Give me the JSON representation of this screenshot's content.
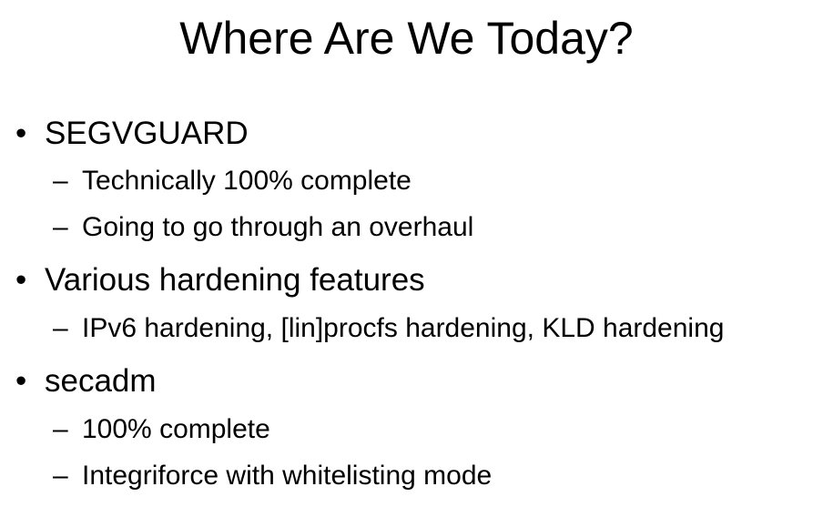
{
  "slide": {
    "title": "Where Are We Today?",
    "bullet_glyph": "•",
    "dash_glyph": "–",
    "items": [
      {
        "text": "SEGVGUARD",
        "subitems": [
          "Technically 100% complete",
          "Going to go through an overhaul"
        ]
      },
      {
        "text": "Various hardening features",
        "subitems": [
          "IPv6 hardening, [lin]procfs hardening, KLD hardening"
        ]
      },
      {
        "text": "secadm",
        "subitems": [
          "100% complete",
          "Integriforce with whitelisting mode"
        ]
      }
    ]
  }
}
